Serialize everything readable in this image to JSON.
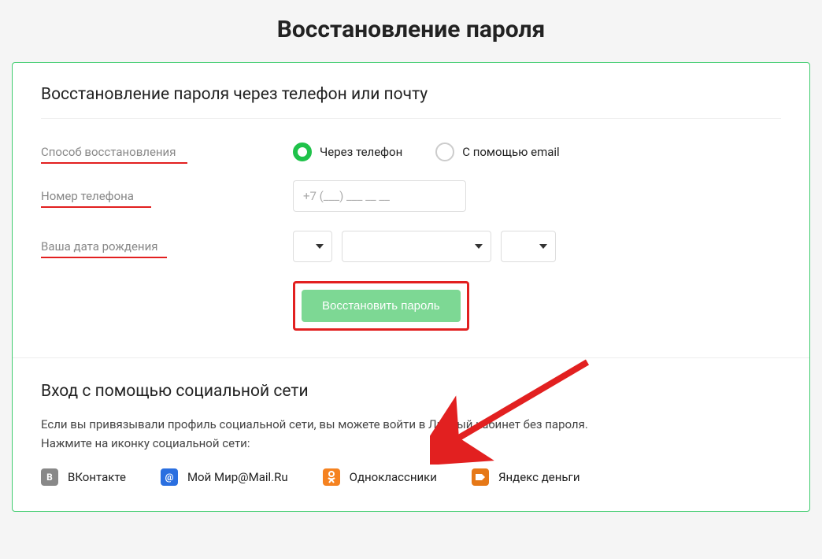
{
  "page": {
    "title": "Восстановление пароля"
  },
  "form": {
    "section_title": "Восстановление пароля через телефон или почту",
    "method_label": "Способ восстановления",
    "method_phone": "Через телефон",
    "method_email": "С помощью email",
    "phone_label": "Номер телефона",
    "phone_placeholder": "+7 (___) ___ __ __",
    "dob_label": "Ваша дата рождения",
    "submit_label": "Восстановить пароль"
  },
  "social": {
    "title": "Вход с помощью социальной сети",
    "description_line1": "Если вы привязывали профиль социальной сети, вы можете войти в Личный кабинет без пароля.",
    "description_line2": "Нажмите на иконку социальной сети:",
    "items": {
      "vk": "ВКонтакте",
      "mailru": "Мой Мир@Mail.Ru",
      "ok": "Одноклассники",
      "yandex": "Яндекс деньги"
    }
  }
}
